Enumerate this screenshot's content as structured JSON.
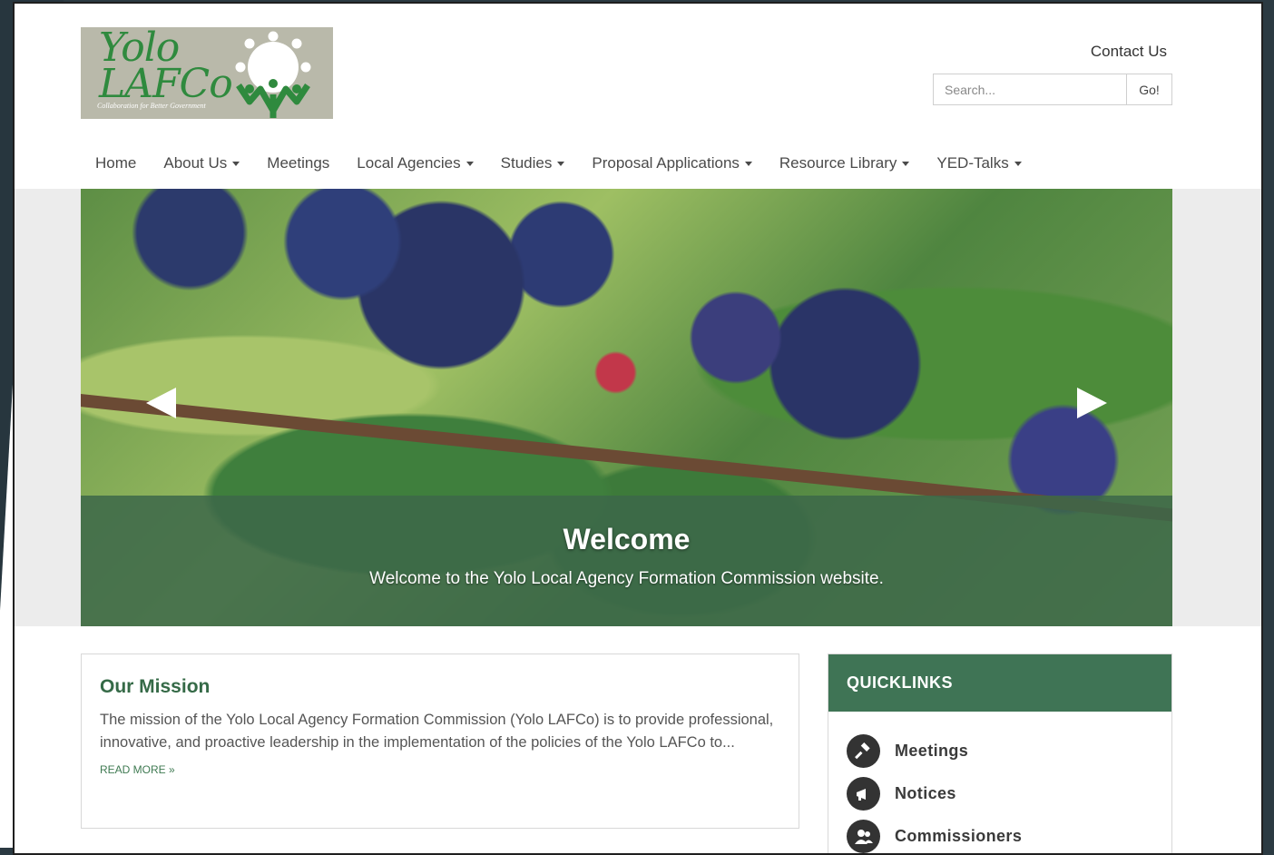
{
  "header": {
    "logo_text_line1": "Yolo",
    "logo_text_line2": "LAFCo",
    "logo_tagline": "Collaboration for Better Government",
    "contact_label": "Contact Us",
    "search": {
      "placeholder": "Search...",
      "button_label": "Go!"
    }
  },
  "nav": {
    "items": [
      {
        "label": "Home",
        "dropdown": false
      },
      {
        "label": "About Us",
        "dropdown": true
      },
      {
        "label": "Meetings",
        "dropdown": false
      },
      {
        "label": "Local Agencies",
        "dropdown": true
      },
      {
        "label": "Studies",
        "dropdown": true
      },
      {
        "label": "Proposal Applications",
        "dropdown": true
      },
      {
        "label": "Resource Library",
        "dropdown": true
      },
      {
        "label": "YED-Talks",
        "dropdown": true
      }
    ]
  },
  "hero": {
    "title": "Welcome",
    "subtitle": "Welcome to the Yolo Local Agency Formation Commission website."
  },
  "mission": {
    "title": "Our Mission",
    "text": "The mission of the Yolo Local Agency Formation Commission (Yolo LAFCo) is to provide professional, innovative, and proactive leadership in the implementation of the policies of the Yolo LAFCo to...",
    "read_more": "READ MORE »"
  },
  "quicklinks": {
    "title": "QUICKLINKS",
    "items": [
      {
        "label": "Meetings",
        "icon": "gavel-icon"
      },
      {
        "label": "Notices",
        "icon": "megaphone-icon"
      },
      {
        "label": "Commissioners",
        "icon": "people-icon"
      }
    ]
  },
  "colors": {
    "brand_green": "#3f7455",
    "heading_green": "#356a47",
    "logo_green": "#2f8a3e"
  }
}
